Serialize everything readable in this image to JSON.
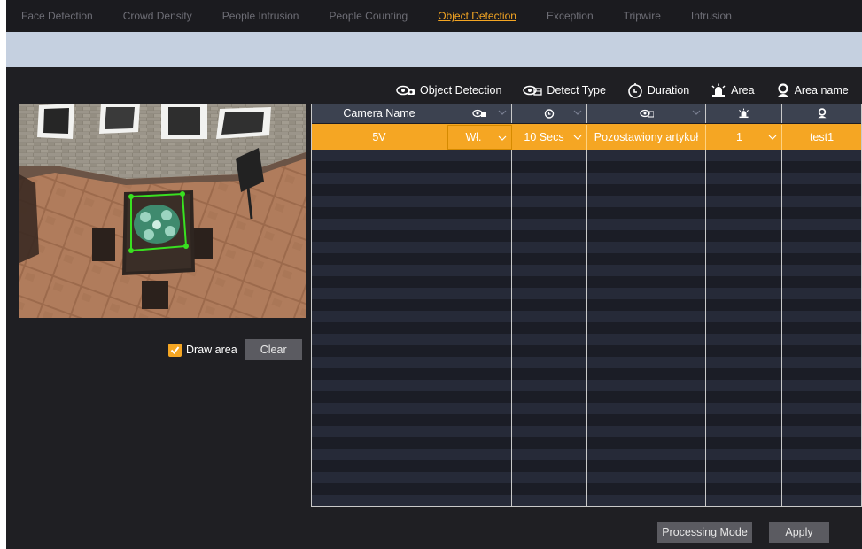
{
  "tabs": [
    {
      "label": "Face Detection",
      "active": false
    },
    {
      "label": "Crowd Density",
      "active": false
    },
    {
      "label": "People Intrusion",
      "active": false
    },
    {
      "label": "People Counting",
      "active": false
    },
    {
      "label": "Object Detection",
      "active": true
    },
    {
      "label": "Exception",
      "active": false
    },
    {
      "label": "Tripwire",
      "active": false
    },
    {
      "label": "Intrusion",
      "active": false
    }
  ],
  "legend": {
    "object_detection": "Object Detection",
    "detect_type": "Detect Type",
    "duration": "Duration",
    "area": "Area",
    "area_name": "Area name"
  },
  "draw_area": {
    "label": "Draw area",
    "checked": true
  },
  "clear_button": "Clear",
  "table": {
    "header": {
      "camera_name": "Camera Name"
    },
    "row": {
      "camera_name": "5V",
      "object_detection": "Wł.",
      "duration": "10 Secs",
      "detect_type": "Pozostawiony artykuł",
      "area": "1",
      "area_name": "test1"
    }
  },
  "buttons": {
    "processing_mode": "Processing Mode",
    "apply": "Apply"
  },
  "colors": {
    "accent": "#f5a623",
    "background": "#1f1f23",
    "banner": "#c5d0e0"
  }
}
